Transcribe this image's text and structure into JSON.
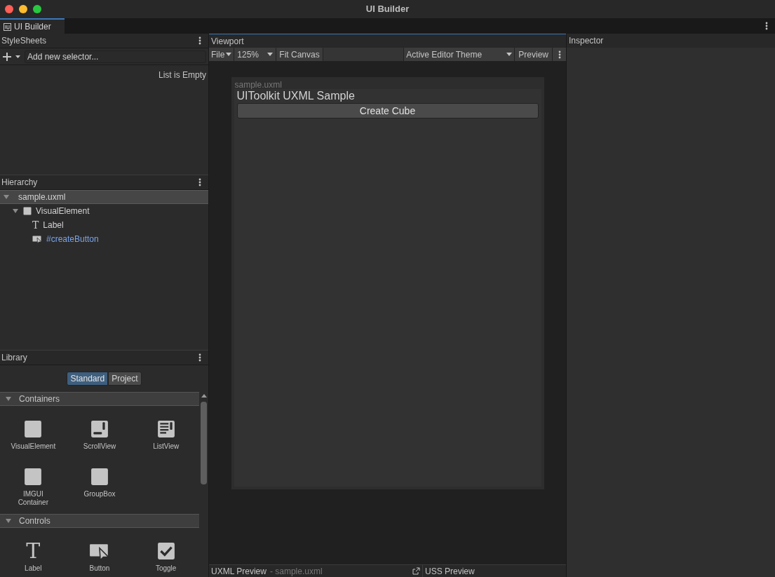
{
  "window": {
    "title": "UI Builder"
  },
  "tabs": [
    {
      "label": "UI Builder",
      "selected": true
    }
  ],
  "stylesheets": {
    "title": "StyleSheets",
    "selector_placeholder": "Add new selector...",
    "empty_text": "List is Empty"
  },
  "hierarchy": {
    "title": "Hierarchy",
    "items": [
      {
        "label": "sample.uxml",
        "kind": "document",
        "selected": true,
        "expanded": true,
        "children": [
          {
            "label": "VisualElement",
            "kind": "visual-element",
            "selected": false,
            "expanded": true,
            "children": [
              {
                "label": "Label",
                "kind": "label",
                "icon_text": "T",
                "selected": false
              },
              {
                "label": "#createButton",
                "kind": "button",
                "selected": false
              }
            ]
          }
        ]
      }
    ]
  },
  "library": {
    "title": "Library",
    "tabs": [
      {
        "label": "Standard",
        "selected": true
      },
      {
        "label": "Project",
        "selected": false
      }
    ],
    "sections": [
      {
        "title": "Containers",
        "expanded": true,
        "items": [
          {
            "label": "VisualElement",
            "kind": "visual-element"
          },
          {
            "label": "ScrollView",
            "kind": "scroll-view"
          },
          {
            "label": "ListView",
            "kind": "list-view"
          },
          {
            "label": "IMGUI Container",
            "kind": "imgui"
          },
          {
            "label": "GroupBox",
            "kind": "group-box"
          }
        ]
      },
      {
        "title": "Controls",
        "expanded": true,
        "items": [
          {
            "label": "Label",
            "kind": "label",
            "icon_text": "T"
          },
          {
            "label": "Button",
            "kind": "button"
          },
          {
            "label": "Toggle",
            "kind": "toggle"
          }
        ]
      }
    ]
  },
  "viewport": {
    "title": "Viewport",
    "toolbar": {
      "file": "File",
      "zoom": "125%",
      "fit": "Fit Canvas",
      "theme": "Active Editor Theme",
      "preview": "Preview"
    },
    "document": {
      "file_name": "sample.uxml",
      "label": "UIToolkit UXML Sample",
      "button": "Create Cube"
    }
  },
  "uxml_preview": {
    "title": "UXML Preview",
    "file": "- sample.uxml"
  },
  "uss_preview": {
    "title": "USS Preview"
  },
  "inspector": {
    "title": "Inspector"
  }
}
